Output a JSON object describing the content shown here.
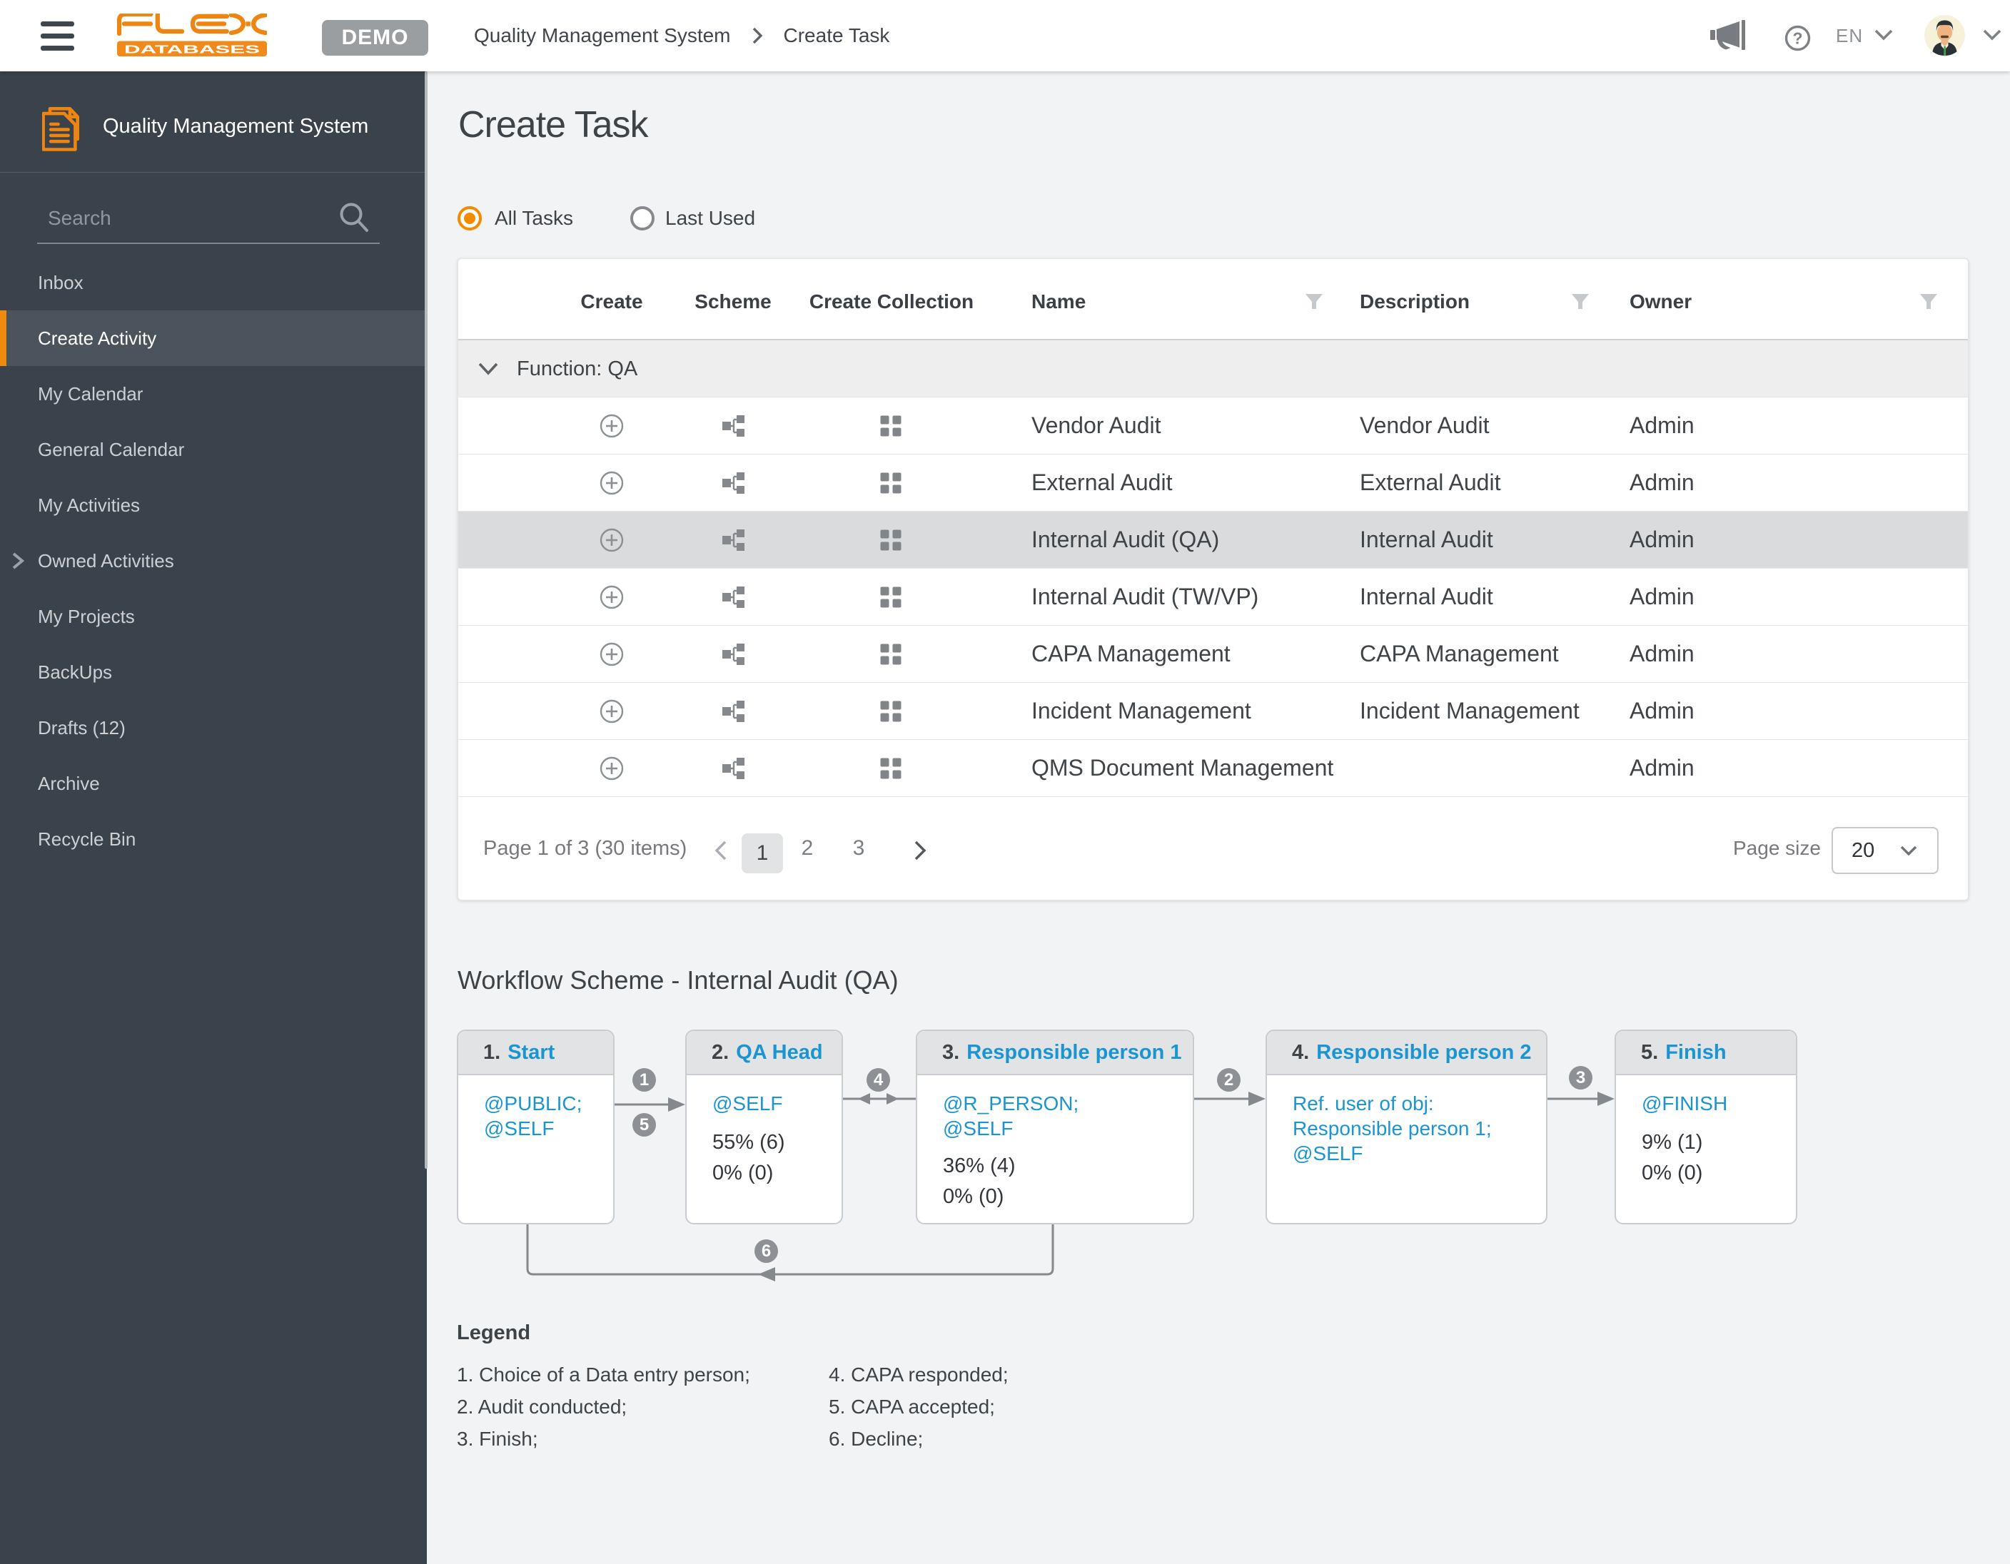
{
  "topbar": {
    "brand": {
      "line1": "FLEX",
      "line2": "DATABASES"
    },
    "demo_label": "DEMO",
    "breadcrumb": {
      "parent": "Quality Management System",
      "current": "Create Task"
    },
    "language": "EN"
  },
  "sidebar": {
    "title": "Quality Management System",
    "search_placeholder": "Search",
    "items": [
      {
        "label": "Inbox"
      },
      {
        "label": "Create Activity"
      },
      {
        "label": "My Calendar"
      },
      {
        "label": "General Calendar"
      },
      {
        "label": "My Activities"
      },
      {
        "label": "Owned Activities"
      },
      {
        "label": "My Projects"
      },
      {
        "label": "BackUps"
      },
      {
        "label": "Drafts (12)"
      },
      {
        "label": "Archive"
      },
      {
        "label": "Recycle Bin"
      }
    ]
  },
  "page": {
    "title": "Create Task"
  },
  "filters": {
    "all_tasks": "All Tasks",
    "last_used": "Last Used"
  },
  "table": {
    "columns": {
      "create": "Create",
      "scheme": "Scheme",
      "collection": "Create Collection",
      "name": "Name",
      "description": "Description",
      "owner": "Owner"
    },
    "group_label": "Function: QA",
    "rows": [
      {
        "name": "Vendor Audit",
        "description": "Vendor Audit",
        "owner": "Admin"
      },
      {
        "name": "External Audit",
        "description": "External Audit",
        "owner": "Admin"
      },
      {
        "name": "Internal Audit (QA)",
        "description": "Internal Audit",
        "owner": "Admin"
      },
      {
        "name": "Internal Audit (TW/VP)",
        "description": "Internal Audit",
        "owner": "Admin"
      },
      {
        "name": "CAPA Management",
        "description": "CAPA Management",
        "owner": "Admin"
      },
      {
        "name": "Incident Management",
        "description": "Incident Management",
        "owner": "Admin"
      },
      {
        "name": "QMS Document Management",
        "description": "",
        "owner": "Admin"
      }
    ],
    "pagination": {
      "summary": "Page 1 of 3 (30 items)",
      "page1": "1",
      "page2": "2",
      "page3": "3",
      "page_size_label": "Page size",
      "page_size": "20"
    }
  },
  "workflow": {
    "heading": "Workflow Scheme - Internal Audit (QA)",
    "steps": [
      {
        "number": "1.",
        "name": "Start",
        "cond1": "@PUBLIC;",
        "cond2": "@SELF",
        "cond3": "",
        "stat1": "",
        "stat2": ""
      },
      {
        "number": "2.",
        "name": "QA Head",
        "cond1": "@SELF",
        "cond2": "",
        "cond3": "",
        "stat1": "55% (6)",
        "stat2": "0% (0)"
      },
      {
        "number": "3.",
        "name": "Responsible person 1",
        "cond1": "@R_PERSON;",
        "cond2": "@SELF",
        "cond3": "",
        "stat1": "36% (4)",
        "stat2": "0% (0)"
      },
      {
        "number": "4.",
        "name": "Responsible person 2",
        "cond1": "Ref. user of obj:",
        "cond2": "Responsible person 1;",
        "cond3": "@SELF",
        "stat1": "",
        "stat2": ""
      },
      {
        "number": "5.",
        "name": "Finish",
        "cond1": "@FINISH",
        "cond2": "",
        "cond3": "",
        "stat1": "9% (1)",
        "stat2": "0% (0)"
      }
    ],
    "badges": {
      "t1": "1",
      "t2": "2",
      "t3": "3",
      "t4": "4",
      "t5": "5",
      "t6": "6"
    }
  },
  "legend": {
    "title": "Legend",
    "item1": "1. Choice of a Data entry person;",
    "item2": "2. Audit conducted;",
    "item3": "3. Finish;",
    "item4": "4. CAPA responded;",
    "item5": "5. CAPA accepted;",
    "item6": "6. Decline;"
  },
  "colors": {
    "accent": "#f08a0e",
    "blue": "#1b95d2",
    "sidebar": "#3a424b"
  }
}
